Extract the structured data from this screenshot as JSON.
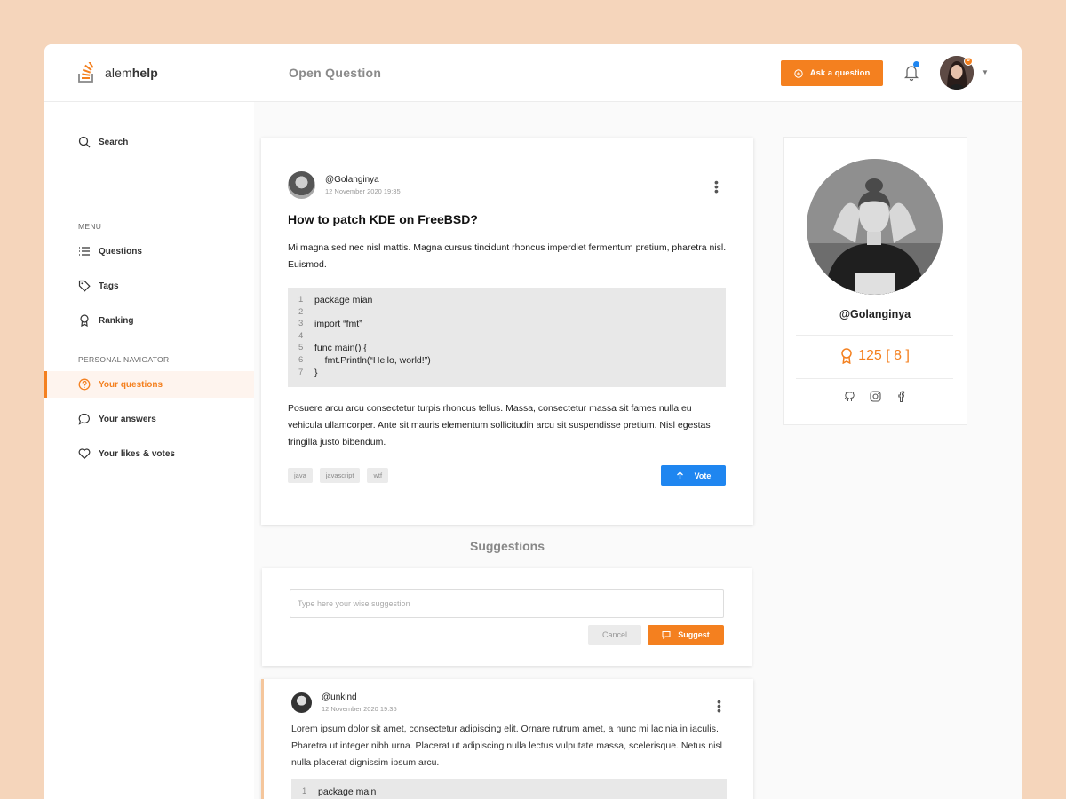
{
  "app": {
    "brand_prefix": "alem",
    "brand_suffix": "help",
    "page_title": "Open Question"
  },
  "header": {
    "ask_label": "Ask a question",
    "avatar_badge": "8"
  },
  "sidebar": {
    "search": "Search",
    "menu_heading": "MENU",
    "menu": [
      {
        "label": "Questions"
      },
      {
        "label": "Tags"
      },
      {
        "label": "Ranking"
      }
    ],
    "personal_heading": "PERSONAL NAVIGATOR",
    "personal": [
      {
        "label": "Your questions"
      },
      {
        "label": "Your answers"
      },
      {
        "label": "Your likes & votes"
      }
    ]
  },
  "question": {
    "author": "@Golanginya",
    "date": "12 November 2020 19:35",
    "title": "How to patch KDE on FreeBSD?",
    "body1": "Mi magna sed nec nisl mattis. Magna cursus tincidunt rhoncus imperdiet fermentum pretium, pharetra nisl. Euismod.",
    "code": [
      {
        "n": "1",
        "t": "package mian"
      },
      {
        "n": "2",
        "t": ""
      },
      {
        "n": "3",
        "t": "import “fmt”"
      },
      {
        "n": "4",
        "t": ""
      },
      {
        "n": "5",
        "t": "func main() {"
      },
      {
        "n": "6",
        "t": "    fmt.Println(“Hello, world!”)"
      },
      {
        "n": "7",
        "t": "}"
      }
    ],
    "body2": "Posuere arcu arcu consectetur turpis rhoncus tellus. Massa, consectetur massa sit fames nulla eu vehicula ullamcorper. Ante sit mauris elementum sollicitudin arcu sit suspendisse pretium. Nisl egestas fringilla justo bibendum.",
    "tags": [
      "java",
      "javascript",
      "wtf"
    ],
    "vote_label": "Vote"
  },
  "suggestions": {
    "title": "Suggestions",
    "placeholder": "Type here your wise suggestion",
    "cancel_label": "Cancel",
    "suggest_label": "Suggest"
  },
  "answer": {
    "author": "@unkind",
    "date": "12 November 2020 19:35",
    "body": "Lorem ipsum dolor sit amet, consectetur adipiscing elit. Ornare rutrum amet, a nunc mi lacinia in iaculis. Pharetra ut integer nibh urna. Placerat ut adipiscing nulla lectus vulputate massa, scelerisque. Netus nisl nulla placerat dignissim ipsum arcu.",
    "code": [
      {
        "n": "1",
        "t": "package main"
      }
    ]
  },
  "profile": {
    "name": "@Golanginya",
    "score": "125 [ 8 ]"
  },
  "colors": {
    "accent": "#f4801f",
    "blue": "#1f86f0",
    "background": "#f5d5bb"
  },
  "icons": [
    "search-icon",
    "list-icon",
    "tag-icon",
    "award-icon",
    "question-circle-icon",
    "chat-bubble-icon",
    "heart-icon",
    "bell-icon",
    "plus-circle-icon",
    "arrow-up-icon",
    "kebab-icon",
    "github-icon",
    "instagram-icon",
    "facebook-icon"
  ]
}
